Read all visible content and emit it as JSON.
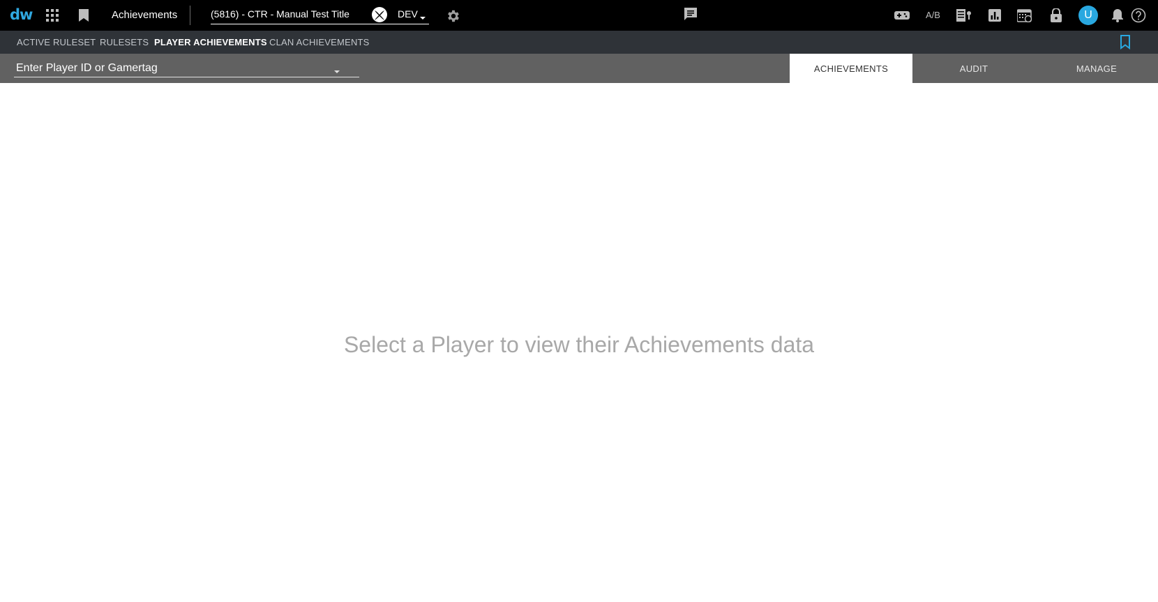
{
  "topbar": {
    "logo": "dw",
    "app_title": "Achievements",
    "title_select": "(5816) - CTR - Manual Test Title",
    "environment": "DEV",
    "ab_label": "A/B",
    "avatar_initial": "U"
  },
  "subnav": {
    "items": [
      {
        "label": "ACTIVE RULESET"
      },
      {
        "label": "RULESETS"
      },
      {
        "label": "PLAYER ACHIEVEMENTS"
      },
      {
        "label": "CLAN ACHIEVEMENTS"
      }
    ],
    "active_index": 2
  },
  "toolbar": {
    "player_placeholder": "Enter Player ID or Gamertag",
    "tabs": [
      {
        "label": "ACHIEVEMENTS"
      },
      {
        "label": "AUDIT"
      },
      {
        "label": "MANAGE"
      }
    ],
    "active_tab": 0
  },
  "main": {
    "empty_message": "Select a Player to view their Achievements data"
  },
  "colors": {
    "accent": "#29a8e0",
    "topbar_bg": "#000000",
    "subnav_bg": "#2f3338",
    "toolbar_bg": "#616161"
  },
  "icons": [
    "apps-icon",
    "bookmark-icon",
    "xbox-icon",
    "caret-down-icon",
    "gear-icon",
    "chat-icon",
    "gamepad-icon",
    "ab-test-icon",
    "content-icon",
    "bar-chart-icon",
    "calendar-icon",
    "lock-icon",
    "avatar",
    "bell-icon",
    "help-icon"
  ]
}
